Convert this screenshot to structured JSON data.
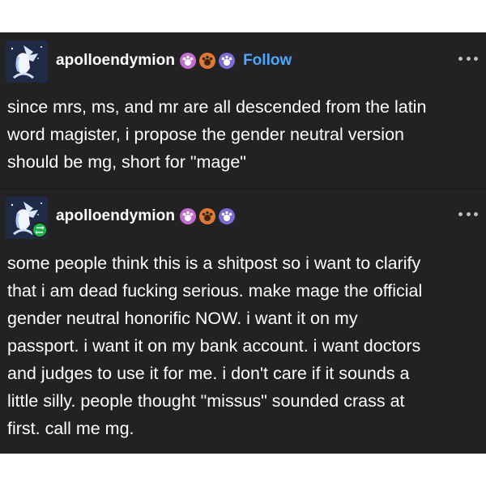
{
  "colors": {
    "background": "#222222",
    "text": "#ffffff",
    "link": "#4aa8ff",
    "badge_pink": "#c26bd1",
    "badge_orange": "#e07a2e",
    "badge_purple": "#7f6ad8",
    "reblog_green": "#19b54a"
  },
  "posts": [
    {
      "username": "apolloendymion",
      "follow_label": "Follow",
      "badges": [
        "paw-badge-icon",
        "paw-badge-icon",
        "paw-badge-icon"
      ],
      "lines": [
        "since mrs, ms, and mr are all descended from the latin",
        "word magister, i propose the gender neutral version",
        "should be mg, short for \"mage\""
      ]
    },
    {
      "username": "apolloendymion",
      "badges": [
        "paw-badge-icon",
        "paw-badge-icon",
        "paw-badge-icon"
      ],
      "reblog_icon": "reblog-icon",
      "lines": [
        "some people think this is a shitpost so i want to clarify",
        "that i am dead fucking serious. make mage the official",
        "gender neutral honorific NOW. i want it on my",
        "passport. i want it on my bank account. i want doctors",
        "and judges to use it for me. i don't care if it sounds a",
        "little silly. people thought \"missus\" sounded crass at",
        "first. call me mg."
      ]
    }
  ]
}
